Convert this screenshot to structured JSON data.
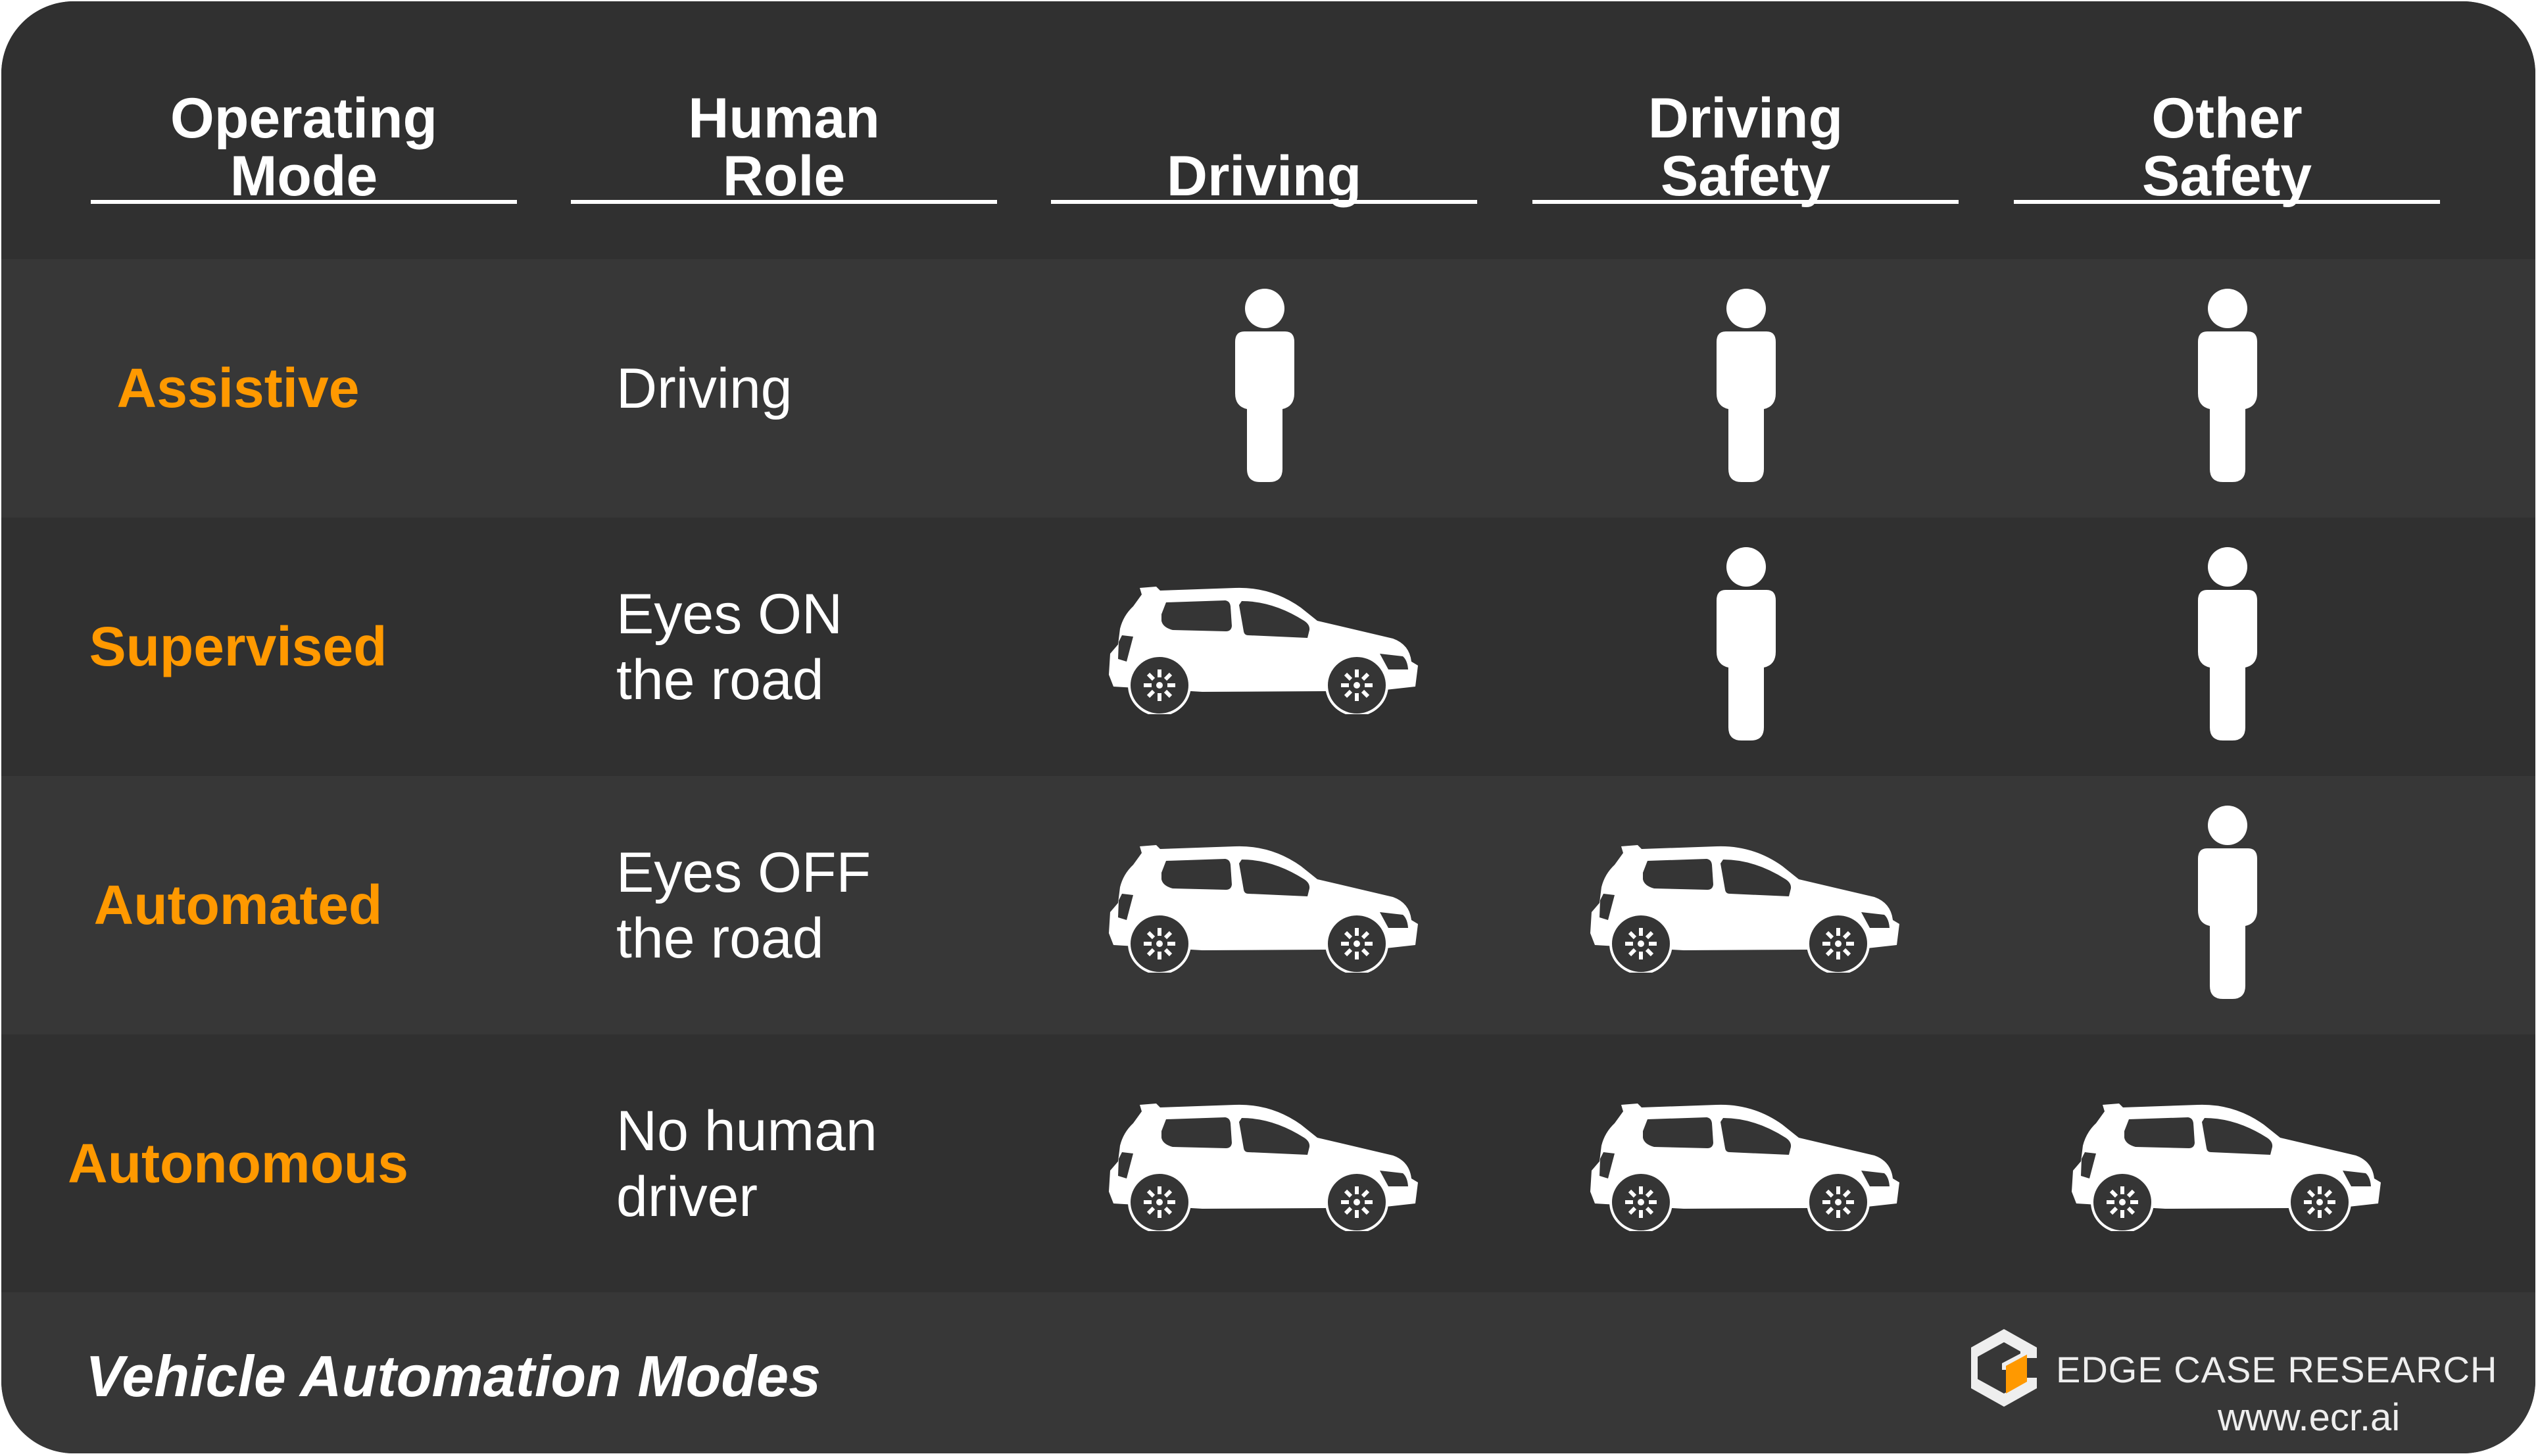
{
  "title": "Vehicle Automation Modes",
  "colors": {
    "background_dark": "#303030",
    "background_light": "#373737",
    "accent": "#ff9900",
    "text": "#ffffff"
  },
  "columns": [
    {
      "line1": "Operating",
      "line2": "Mode"
    },
    {
      "line1": "Human",
      "line2": "Role"
    },
    {
      "line1": "",
      "line2": "Driving"
    },
    {
      "line1": "Driving",
      "line2": "Safety"
    },
    {
      "line1": "Other",
      "line2": "Safety"
    }
  ],
  "rows": [
    {
      "mode": "Assistive",
      "role_line1": "Driving",
      "role_line2": "",
      "driving": "person-icon",
      "driving_safety": "person-icon",
      "other_safety": "person-icon"
    },
    {
      "mode": "Supervised",
      "role_line1": "Eyes ON",
      "role_line2": "the road",
      "driving": "car-icon",
      "driving_safety": "person-icon",
      "other_safety": "person-icon"
    },
    {
      "mode": "Automated",
      "role_line1": "Eyes OFF",
      "role_line2": "the road",
      "driving": "car-icon",
      "driving_safety": "car-icon",
      "other_safety": "person-icon"
    },
    {
      "mode": "Autonomous",
      "role_line1": "No human",
      "role_line2": "driver",
      "driving": "car-icon",
      "driving_safety": "car-icon",
      "other_safety": "car-icon"
    }
  ],
  "brand": {
    "name": "EDGE CASE RESEARCH",
    "url": "www.ecr.ai",
    "logo": "ecr-cube-logo-icon"
  }
}
